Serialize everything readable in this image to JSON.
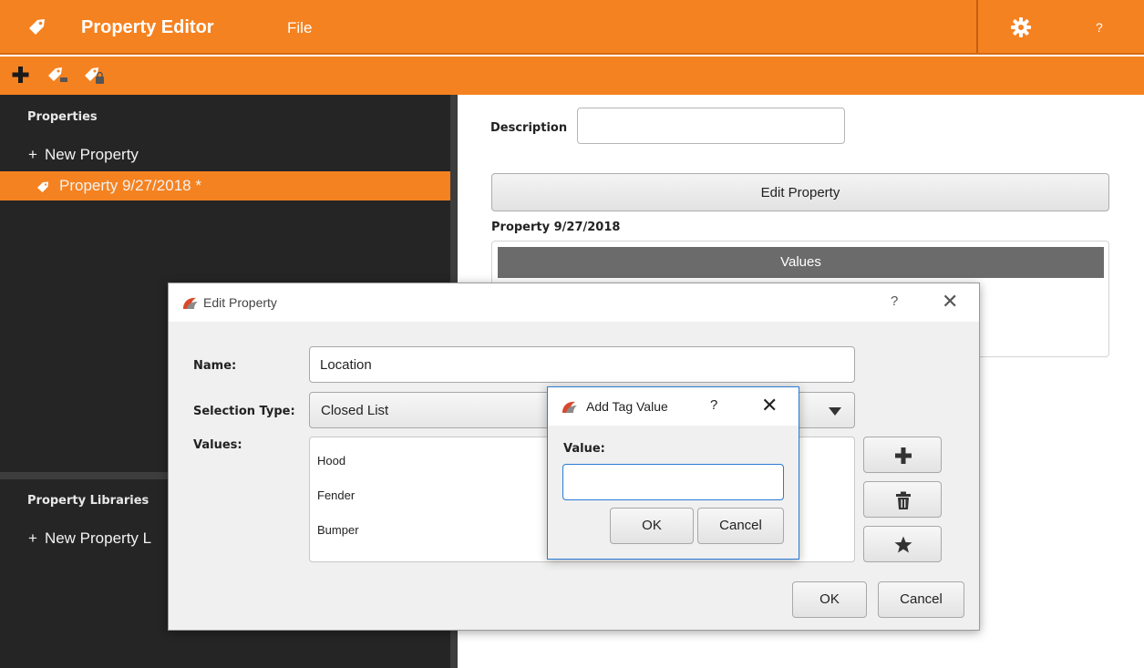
{
  "app": {
    "title": "Property Editor",
    "menu_file": "File",
    "help_label": "?",
    "accent_color": "#f58220"
  },
  "toolbar": {
    "buttons": [
      "add-icon",
      "add-tag-icon",
      "tag-lock-icon"
    ]
  },
  "left": {
    "properties_heading": "Properties",
    "new_property_label": "New Property",
    "items": [
      {
        "label": "Property 9/27/2018 *",
        "selected": true
      }
    ],
    "libraries_heading": "Property Libraries",
    "new_library_label": "New Property L"
  },
  "right": {
    "description_label": "Description",
    "description_value": "",
    "edit_property_button": "Edit Property",
    "property_title": "Property 9/27/2018",
    "values_header": "Values"
  },
  "edit_dialog": {
    "title": "Edit Property",
    "help_label": "?",
    "close_label": "✕",
    "name_label": "Name:",
    "name_value": "Location",
    "selection_type_label": "Selection Type:",
    "selection_type_value": "Closed List",
    "values_label": "Values:",
    "values": [
      "Hood",
      "Fender",
      "Bumper"
    ],
    "ok_label": "OK",
    "cancel_label": "Cancel"
  },
  "tag_dialog": {
    "title": "Add Tag Value",
    "help_label": "?",
    "close_label": "✕",
    "value_label": "Value:",
    "value_input": "",
    "ok_label": "OK",
    "cancel_label": "Cancel"
  }
}
